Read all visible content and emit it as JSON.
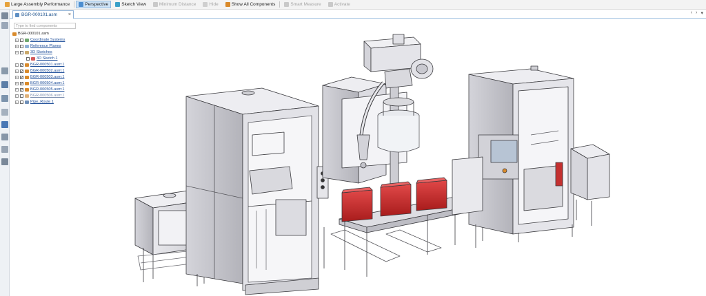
{
  "toolbar": {
    "items": [
      {
        "label": "Large Assembly Performance",
        "icon": "performance-icon",
        "state": "normal"
      },
      {
        "label": "Perspective",
        "icon": "perspective-icon",
        "state": "active"
      },
      {
        "label": "Sketch View",
        "icon": "sketch-view-icon",
        "state": "normal"
      },
      {
        "label": "Minimum Distance",
        "icon": "minimum-distance-icon",
        "state": "disabled"
      },
      {
        "label": "Hide",
        "icon": "hide-icon",
        "state": "disabled"
      },
      {
        "label": "Show All Components",
        "icon": "show-all-icon",
        "state": "normal"
      },
      {
        "label": "Smart Measure",
        "icon": "smart-measure-icon",
        "state": "disabled"
      },
      {
        "label": "Activate",
        "icon": "activate-icon",
        "state": "disabled"
      }
    ]
  },
  "tab": {
    "label": "BGR-000101.asm",
    "close": "×"
  },
  "tab_nav": {
    "left": "‹",
    "right": "›",
    "menu": "▾"
  },
  "tree": {
    "search_placeholder": "Type to find components",
    "root": "BGR-000101.asm",
    "items": [
      {
        "label": "Coordinate Systems",
        "expand": "+"
      },
      {
        "label": "Reference Planes",
        "expand": "+"
      },
      {
        "label": "3D Sketches",
        "expand": "−"
      },
      {
        "label": "3D Sketch 1",
        "expand": ""
      },
      {
        "label": "BGR-000501.asm:1",
        "expand": "+"
      },
      {
        "label": "BGR-000502.asm:1",
        "expand": "+"
      },
      {
        "label": "BGR-000503.asm:1",
        "expand": "+"
      },
      {
        "label": "BGR-000504.asm:1",
        "expand": "+"
      },
      {
        "label": "BGR-000505.asm:1",
        "expand": "+"
      },
      {
        "label": "BGR-000506.asm:1",
        "expand": "+"
      },
      {
        "label": "Pipe_Route 1",
        "expand": "+"
      }
    ]
  },
  "left_strip": {
    "icons": [
      "assembly-icon",
      "features-icon",
      "display-icon",
      "layers-icon",
      "pmi-icon",
      "model-icon",
      "help-icon",
      "structure-icon",
      "settings-icon",
      "properties-icon"
    ]
  },
  "viewport": {
    "content": "3D assembly model of packaging machine line"
  }
}
